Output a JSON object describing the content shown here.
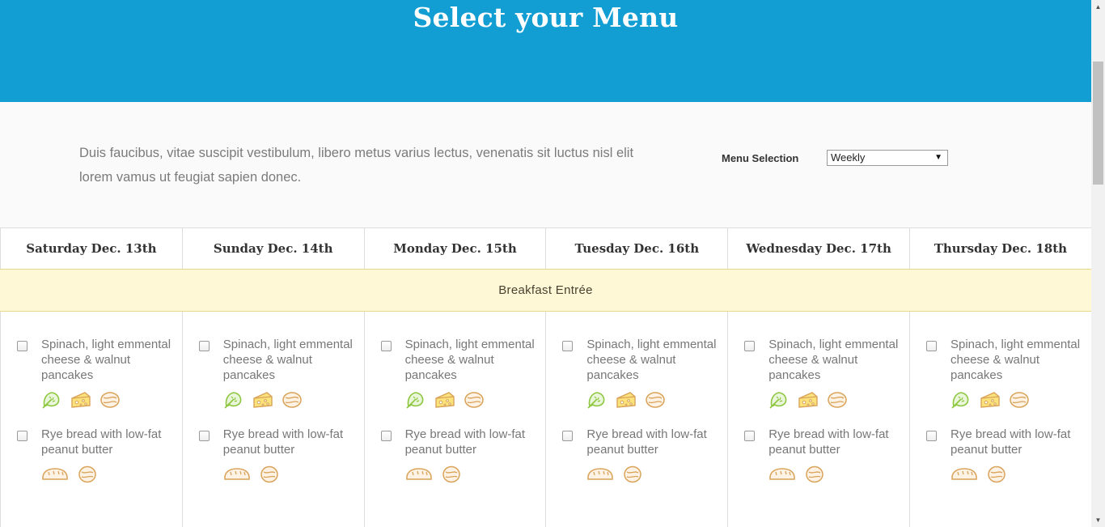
{
  "header": {
    "title": "Select your Menu"
  },
  "intro": {
    "text": "Duis faucibus, vitae suscipit vestibulum, libero metus varius lectus, venenatis sit luctus nisl elit lorem vamus ut feugiat sapien donec."
  },
  "menu_selection": {
    "label": "Menu Selection",
    "value": "Weekly"
  },
  "days": [
    {
      "label": "Saturday Dec. 13th"
    },
    {
      "label": "Sunday Dec. 14th"
    },
    {
      "label": "Monday Dec. 15th"
    },
    {
      "label": "Tuesday Dec. 16th"
    },
    {
      "label": "Wednesday Dec. 17th"
    },
    {
      "label": "Thursday Dec. 18th"
    }
  ],
  "section": {
    "title": "Breakfast Entrée"
  },
  "items": [
    {
      "text": "Spinach, light emmental cheese & walnut pancakes",
      "icons": [
        "spinach-icon",
        "cheese-icon",
        "walnut-icon"
      ],
      "checked": false
    },
    {
      "text": "Rye bread with low-fat peanut butter",
      "icons": [
        "bread-icon",
        "peanut-icon"
      ],
      "checked": false
    }
  ],
  "colors": {
    "header_bg": "#139ed3",
    "section_bg": "#fff8d6",
    "icon_green": "#8dc63f",
    "icon_orange": "#d9a35a",
    "icon_yellow": "#f5c518"
  }
}
